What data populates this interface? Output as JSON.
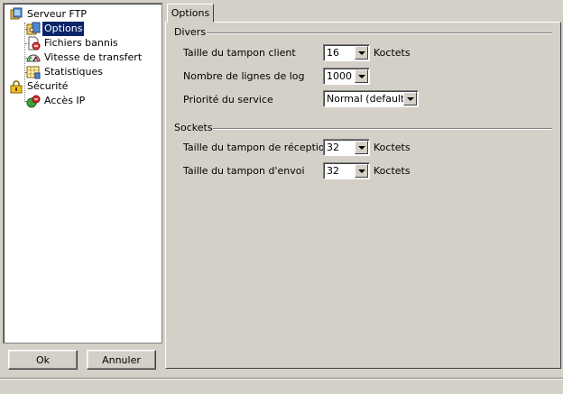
{
  "tree": {
    "root_label": "Serveur FTP",
    "root_children": [
      "Options",
      "Fichiers bannis",
      "Vitesse de transfert",
      "Statistiques"
    ],
    "security_label": "Sécurité",
    "security_children": [
      "Accès IP"
    ],
    "selected": "Options"
  },
  "buttons": {
    "ok": "Ok",
    "cancel": "Annuler"
  },
  "tab": {
    "label": "Options"
  },
  "divers": {
    "title": "Divers",
    "client_buffer_label": "Taille du tampon client",
    "client_buffer_value": "16",
    "client_buffer_unit": "Koctets",
    "log_lines_label": "Nombre de lignes de log",
    "log_lines_value": "1000",
    "priority_label": "Priorité du service",
    "priority_value": "Normal (default)"
  },
  "sockets": {
    "title": "Sockets",
    "recv_label": "Taille du tampon de réception",
    "recv_value": "32",
    "recv_unit": "Koctets",
    "send_label": "Taille du tampon d'envoi",
    "send_value": "32",
    "send_unit": "Koctets"
  }
}
